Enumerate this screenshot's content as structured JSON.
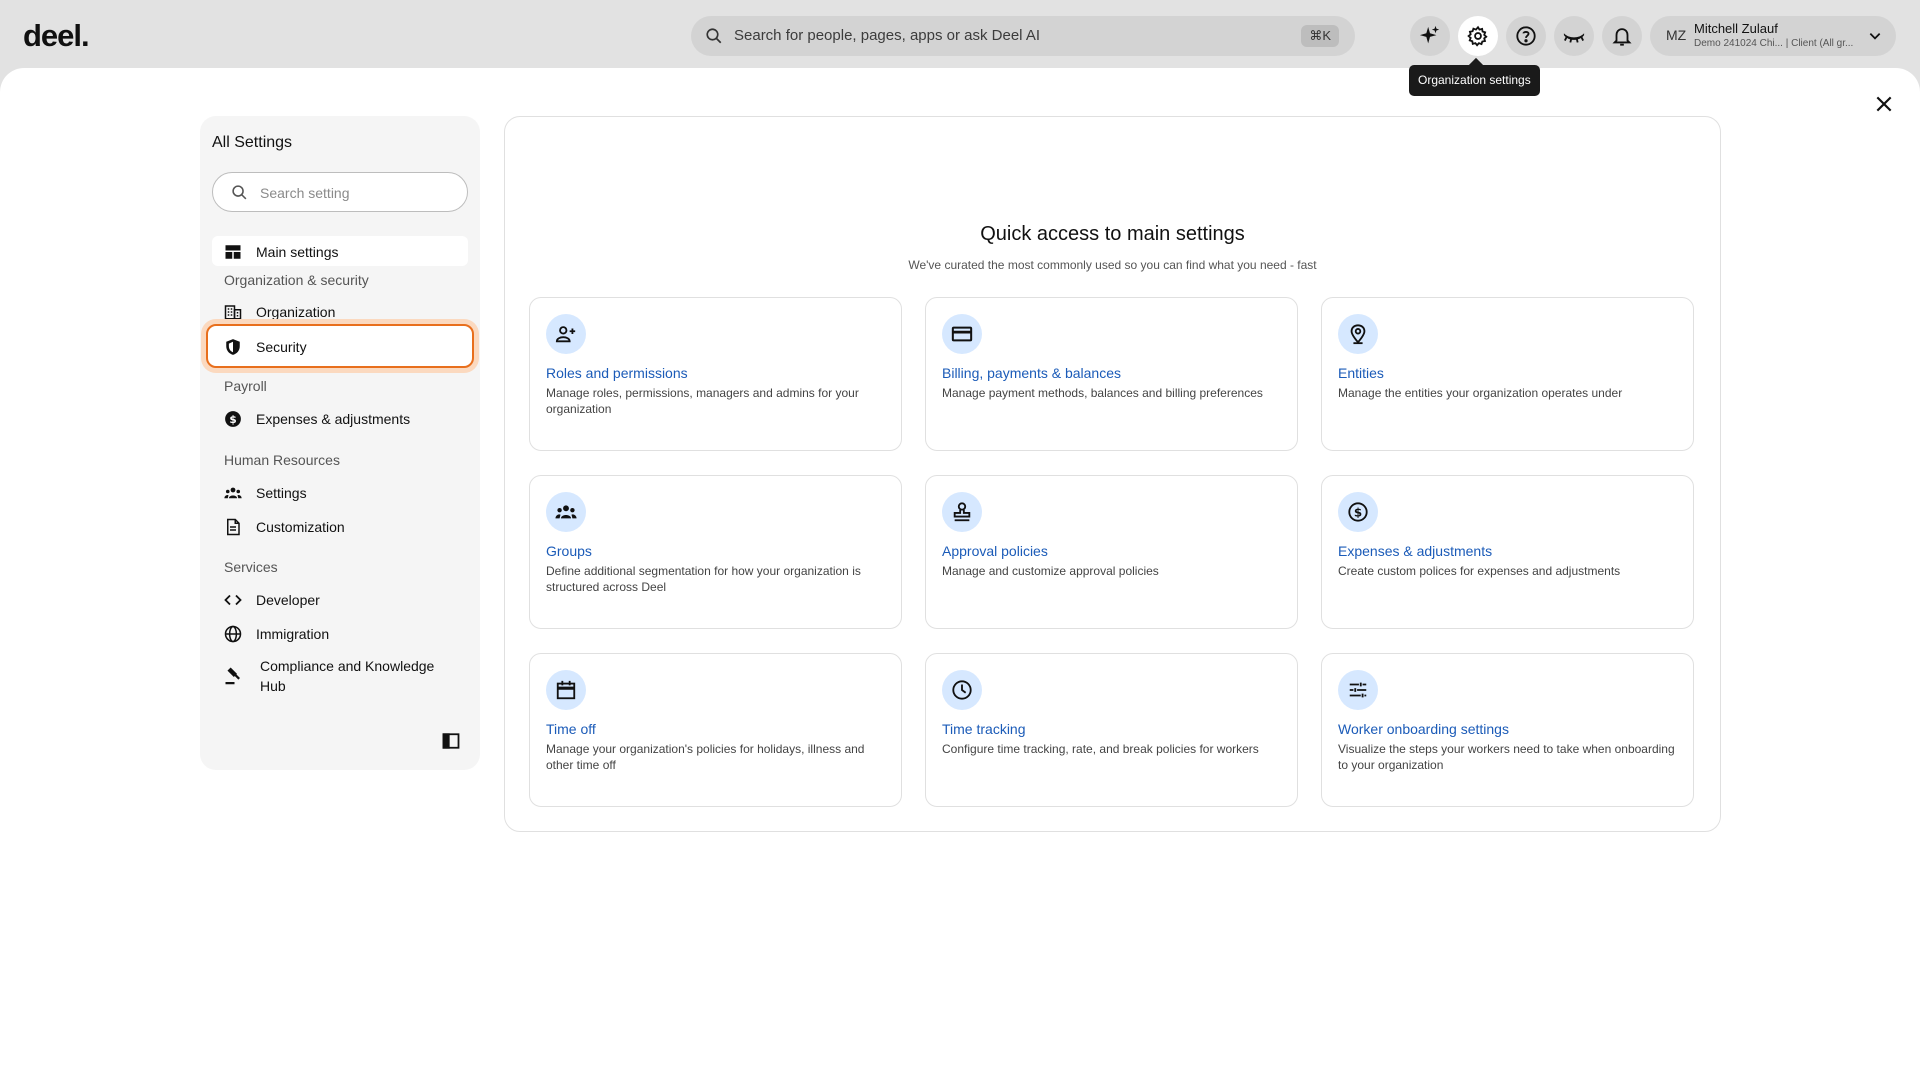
{
  "topbar": {
    "logo": "deel.",
    "search_placeholder": "Search for people, pages, apps or ask Deel AI",
    "search_shortcut": "⌘K",
    "user_initials": "MZ",
    "user_name": "Mitchell Zulauf",
    "user_subtitle": "Demo 241024 Chi... | Client (All gr...",
    "tooltip": "Organization settings"
  },
  "sidebar": {
    "title": "All Settings",
    "search_placeholder": "Search setting",
    "main_settings": "Main settings",
    "sections": {
      "org_security": "Organization & security",
      "payroll": "Payroll",
      "hr": "Human Resources",
      "services": "Services"
    },
    "items": {
      "organization": "Organization",
      "security": "Security",
      "expenses": "Expenses & adjustments",
      "hr_settings": "Settings",
      "customization": "Customization",
      "developer": "Developer",
      "immigration": "Immigration",
      "compliance": "Compliance and Knowledge Hub"
    }
  },
  "main": {
    "title": "Quick access to main settings",
    "subtitle": "We've curated the most commonly used so you can find what you need - fast",
    "cards": [
      {
        "title": "Roles and permissions",
        "desc": "Manage roles, permissions, managers and admins for your organization",
        "icon": "user-plus-icon"
      },
      {
        "title": "Billing, payments & balances",
        "desc": "Manage payment methods, balances and billing preferences",
        "icon": "credit-card-icon"
      },
      {
        "title": "Entities",
        "desc": "Manage the entities your organization operates under",
        "icon": "location-pin-icon"
      },
      {
        "title": "Groups",
        "desc": "Define additional segmentation for how your organization is structured across Deel",
        "icon": "groups-icon"
      },
      {
        "title": "Approval policies",
        "desc": "Manage and customize approval policies",
        "icon": "stamp-icon"
      },
      {
        "title": "Expenses & adjustments",
        "desc": "Create custom polices for expenses and adjustments",
        "icon": "dollar-circle-icon"
      },
      {
        "title": "Time off",
        "desc": "Manage your organization's policies for holidays, illness and other time off",
        "icon": "calendar-icon"
      },
      {
        "title": "Time tracking",
        "desc": "Configure time tracking, rate, and break policies for workers",
        "icon": "clock-icon"
      },
      {
        "title": "Worker onboarding settings",
        "desc": "Visualize the steps your workers need to take when onboarding to your organization",
        "icon": "sliders-icon"
      }
    ]
  },
  "colors": {
    "accent_blue": "#1b5bb8",
    "icon_bg": "#d6e8ff",
    "highlight_orange": "#e86f1d"
  }
}
